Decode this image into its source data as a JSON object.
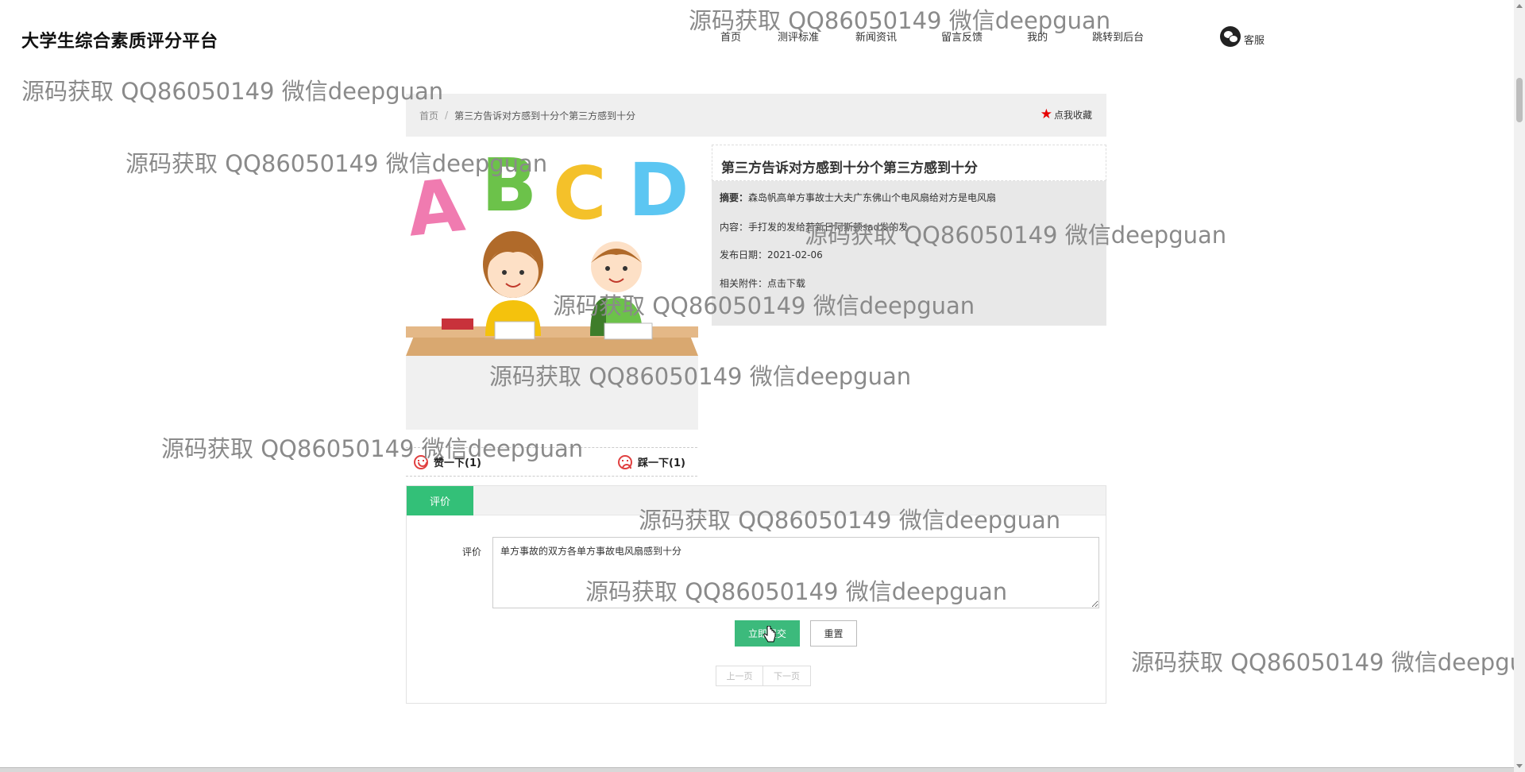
{
  "header": {
    "site_title": "大学生综合素质评分平台",
    "nav": [
      "首页",
      "测评标准",
      "新闻资讯",
      "留言反馈",
      "我的",
      "跳转到后台"
    ],
    "service_label": "客服"
  },
  "breadcrumb": {
    "home": "首页",
    "separator": "/",
    "current": "第三方告诉对方感到十分个第三方感到十分",
    "favorite_label": "点我收藏"
  },
  "article": {
    "title": "第三方告诉对方感到十分个第三方感到十分",
    "summary_label": "摘要：",
    "summary": "森岛帆高单方事故士大夫广东佛山个电风扇给对方是电风扇",
    "content_label": "内容：",
    "content": "手打发的发给若新日阿斯顿sad发的发",
    "date_label": "发布日期：",
    "date": "2021-02-06",
    "attachment_label": "相关附件：",
    "attachment_link": "点击下载"
  },
  "votes": {
    "like": "赞一下(1)",
    "dislike": "踩一下(1)"
  },
  "comment": {
    "tab": "评价",
    "field_label": "评价",
    "value": "单方事故的双方各单方事故电风扇感到十分",
    "submit": "立即提交",
    "reset": "重置",
    "prev": "上一页",
    "next": "下一页"
  },
  "watermark": "源码获取 QQ86050149 微信deepguan",
  "colors": {
    "accent_green": "#33c078",
    "star_red": "#e60000",
    "panel_gray": "#e8e8e8"
  }
}
